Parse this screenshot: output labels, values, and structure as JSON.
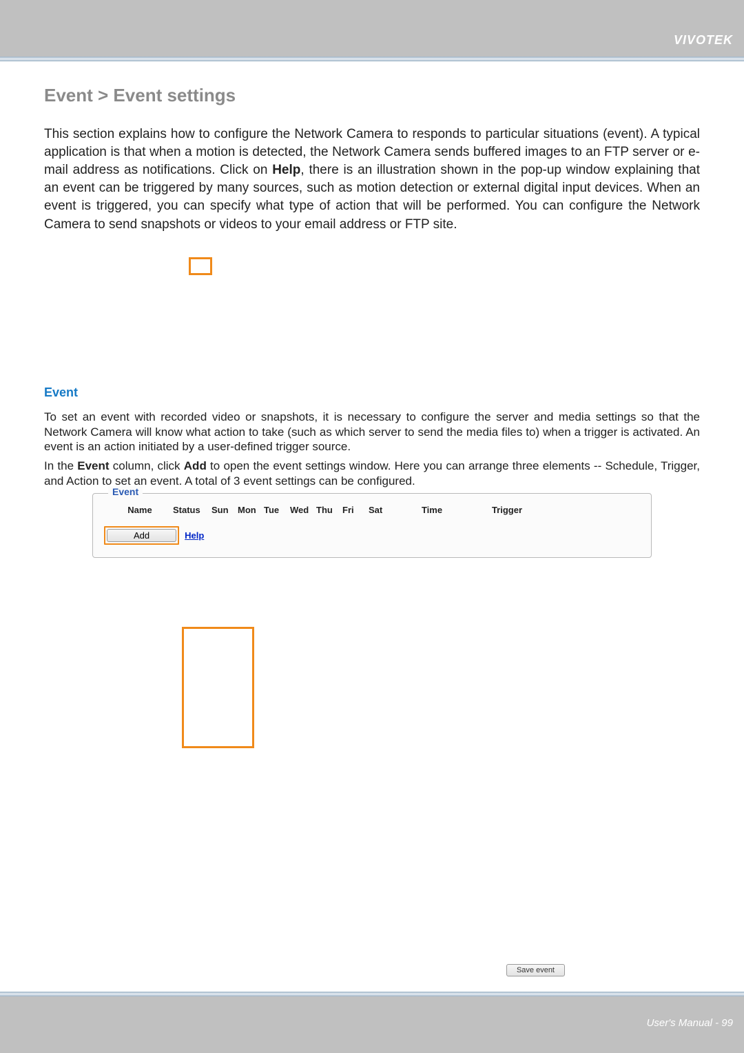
{
  "brand": "VIVOTEK",
  "footer": "User's Manual - 99",
  "heading": "Event > Event settings",
  "intro_part1": "This section explains how to configure the Network Camera to responds to particular situations (event). A typical application is that when a motion is detected, the Network Camera sends buffered images to an FTP server or e-mail address as notifications. Click on ",
  "intro_help": "Help",
  "intro_part2": ", there is an illustration shown in the pop-up window explaining that an event can be triggered by many sources, such as motion detection or external digital input devices. When an event is triggered, you can specify what type of action that will be performed. You can configure the Network Camera to send snapshots or videos to your email address or FTP site.",
  "section_event": "Event",
  "event_para_1": "To set an event with recorded video or snapshots, it is necessary to configure the server and media settings so that the Network Camera will know what action to take (such as which server to send the media files to) when a trigger is activated. An event is an action initiated by a user-defined trigger source.",
  "event_para_2a": "In the ",
  "event_bold_event": "Event",
  "event_para_2b": "  column, click ",
  "event_bold_add": "Add",
  "event_para_2c": " to open the event settings window. Here you can arrange three elements -- Schedule, Trigger, and Action to set an event. A total of 3 event settings can be configured.",
  "event_box": {
    "legend": "Event",
    "headers": {
      "name": "Name",
      "status": "Status",
      "sun": "Sun",
      "mon": "Mon",
      "tue": "Tue",
      "wed": "Wed",
      "thu": "Thu",
      "fri": "Fri",
      "sat": "Sat",
      "time": "Time",
      "trigger": "Trigger"
    },
    "add_label": "Add",
    "help_label": "Help"
  },
  "save_event_label": "Save event"
}
